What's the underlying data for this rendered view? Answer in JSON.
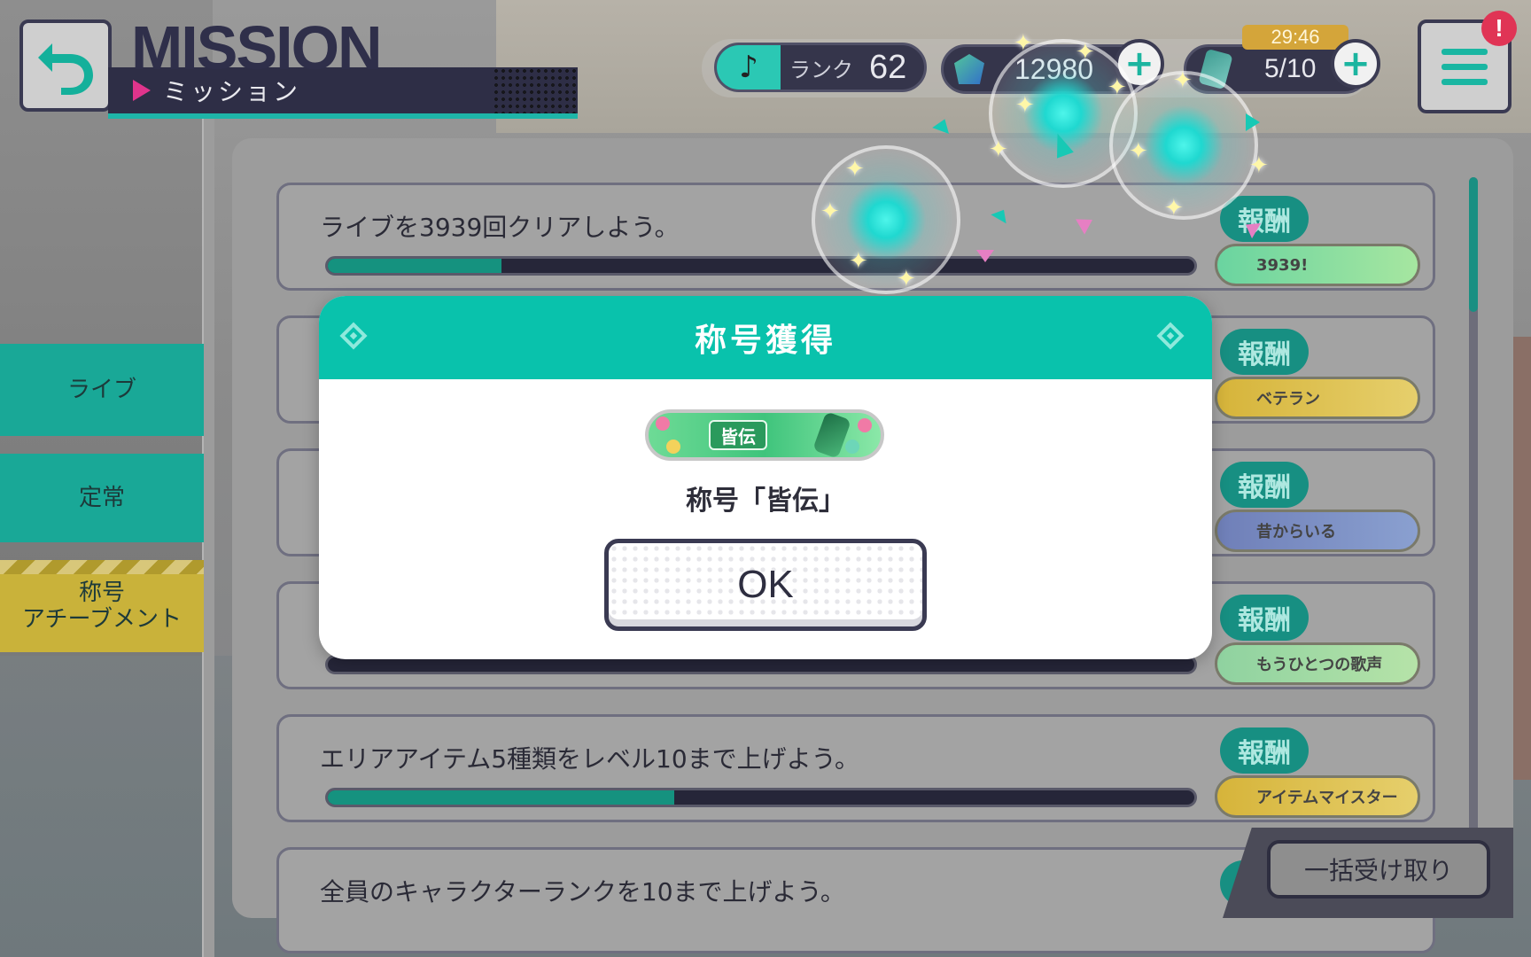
{
  "header": {
    "title_en": "MISSION",
    "title_jp": "ミッション",
    "rank_label": "ランク",
    "rank_value": "62",
    "gems": "12980",
    "energy_timer": "29:46",
    "energy": "5/10",
    "alert": "!"
  },
  "sidebar": {
    "items": [
      {
        "label": "ライブ"
      },
      {
        "label": "定常"
      },
      {
        "label_line1": "称号",
        "label_line2": "アチーブメント"
      }
    ]
  },
  "missions": [
    {
      "text": "ライブを3939回クリアしよう。",
      "progress": 0.2,
      "reward_label": "報酬",
      "reward": "3939!"
    },
    {
      "text": "",
      "progress": 0,
      "reward_label": "報酬",
      "reward": "ベテラン"
    },
    {
      "text": "",
      "progress": 0,
      "reward_label": "報酬",
      "reward": "昔からいる"
    },
    {
      "text": "",
      "progress": 0,
      "reward_label": "報酬",
      "reward": "もうひとつの歌声"
    },
    {
      "text": "エリアアイテム5種類をレベル10まで上げよう。",
      "progress": 0.4,
      "reward_label": "報酬",
      "reward": "アイテムマイスター"
    },
    {
      "text": "全員のキャラクターランクを10まで上げよう。",
      "progress": 0,
      "reward_label": "報酬",
      "reward": ""
    }
  ],
  "bulk_receive": "一括受け取り",
  "modal": {
    "title": "称号獲得",
    "badge_text": "皆伝",
    "caption": "称号「皆伝」",
    "ok_label": "OK"
  },
  "colors": {
    "accent": "#09c2ac",
    "dark": "#2e2e46",
    "alert": "#e03455"
  },
  "icons": [
    "back-arrow-icon",
    "music-note-icon",
    "gem-icon",
    "plus-icon",
    "energy-can-icon",
    "menu-icon",
    "diamond-icon",
    "bottle-icon"
  ]
}
